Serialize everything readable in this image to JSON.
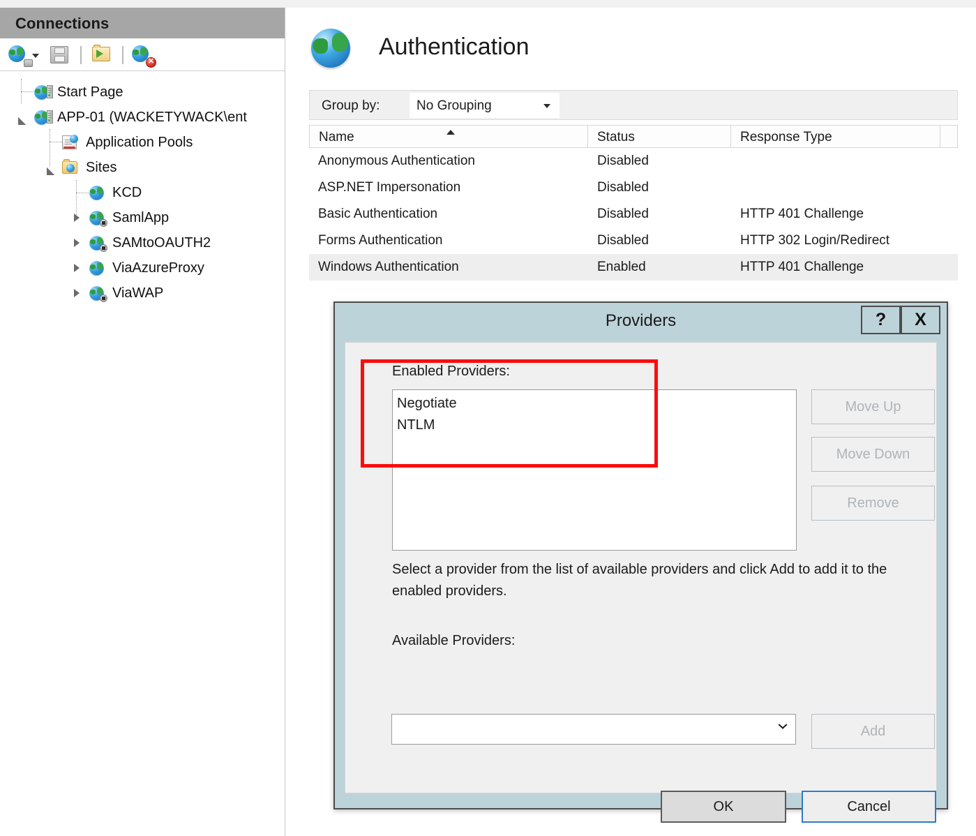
{
  "connections": {
    "header_title": "Connections",
    "toolbar": [
      {
        "name": "connect-to-server-icon",
        "label": "Connect to Server"
      },
      {
        "name": "save-connections-icon",
        "label": "Save Connections"
      },
      {
        "name": "connect-to-site-icon",
        "label": "Connect to a Site"
      },
      {
        "name": "disconnect-icon",
        "label": "Disconnect"
      }
    ],
    "tree": [
      {
        "label": "Start Page",
        "icon": "start-page-icon",
        "depth": 0,
        "expander": "none",
        "selected": false
      },
      {
        "label": "APP-01 (WACKETYWACK\\ent",
        "icon": "server-icon",
        "depth": 0,
        "expander": "expanded",
        "selected": false
      },
      {
        "label": "Application Pools",
        "icon": "application-pools-icon",
        "depth": 1,
        "expander": "none",
        "selected": false
      },
      {
        "label": "Sites",
        "icon": "sites-folder-icon",
        "depth": 1,
        "expander": "expanded",
        "selected": false
      },
      {
        "label": "KCD",
        "icon": "site-icon",
        "depth": 2,
        "expander": "none",
        "selected": true
      },
      {
        "label": "SamlApp",
        "icon": "site-stopped-icon",
        "depth": 2,
        "expander": "collapsed",
        "selected": false
      },
      {
        "label": "SAMtoOAUTH2",
        "icon": "site-stopped-icon",
        "depth": 2,
        "expander": "collapsed",
        "selected": false
      },
      {
        "label": "ViaAzureProxy",
        "icon": "site-icon",
        "depth": 2,
        "expander": "collapsed",
        "selected": false
      },
      {
        "label": "ViaWAP",
        "icon": "site-stopped-icon",
        "depth": 2,
        "expander": "collapsed",
        "selected": false
      }
    ]
  },
  "page": {
    "title": "Authentication",
    "icon": "authentication-globe-icon"
  },
  "groupby": {
    "label": "Group by:",
    "value": "No Grouping"
  },
  "table": {
    "columns": [
      "Name",
      "Status",
      "Response Type"
    ],
    "sort_column": "Name",
    "sort_direction": "ascending",
    "rows": [
      {
        "name": "Anonymous Authentication",
        "status": "Disabled",
        "response_type": "",
        "selected": false
      },
      {
        "name": "ASP.NET Impersonation",
        "status": "Disabled",
        "response_type": "",
        "selected": false
      },
      {
        "name": "Basic Authentication",
        "status": "Disabled",
        "response_type": "HTTP 401 Challenge",
        "selected": false
      },
      {
        "name": "Forms Authentication",
        "status": "Disabled",
        "response_type": "HTTP 302 Login/Redirect",
        "selected": false
      },
      {
        "name": "Windows Authentication",
        "status": "Enabled",
        "response_type": "HTTP 401 Challenge",
        "selected": true
      }
    ]
  },
  "dialog": {
    "title": "Providers",
    "help_label": "?",
    "close_label": "X",
    "enabled_providers_label": "Enabled Providers:",
    "enabled_providers": [
      "Negotiate",
      "NTLM"
    ],
    "move_up_label": "Move Up",
    "move_down_label": "Move Down",
    "remove_label": "Remove",
    "description": "Select a provider from the list of available providers and click Add to add it to the enabled providers.",
    "available_providers_label": "Available Providers:",
    "available_providers_value": "",
    "add_label": "Add",
    "ok_label": "OK",
    "cancel_label": "Cancel",
    "highlight_color": "#fb0d0d"
  }
}
